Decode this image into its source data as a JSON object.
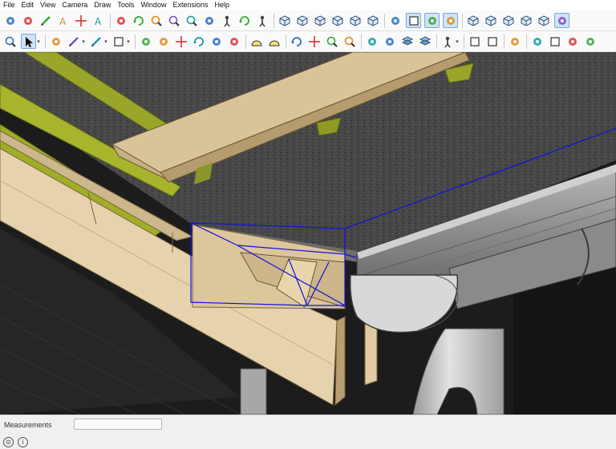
{
  "menu": [
    "File",
    "Edit",
    "View",
    "Camera",
    "Draw",
    "Tools",
    "Window",
    "Extensions",
    "Help"
  ],
  "toolbar_top": [
    {
      "icon": "select-location-icon"
    },
    {
      "icon": "paint-bucket-icon"
    },
    {
      "icon": "pencil-erase-icon"
    },
    {
      "icon": "text-icon"
    },
    {
      "icon": "axes-icon"
    },
    {
      "icon": "text-3d-icon"
    },
    {
      "sep": true
    },
    {
      "icon": "section-plane-icon"
    },
    {
      "icon": "orbit-icon"
    },
    {
      "icon": "zoom-icon"
    },
    {
      "icon": "zoom-window-icon"
    },
    {
      "icon": "zoom-extents-icon"
    },
    {
      "icon": "position-camera-icon"
    },
    {
      "icon": "walk-icon"
    },
    {
      "icon": "look-around-icon"
    },
    {
      "icon": "walker-icon"
    },
    {
      "sep": true
    },
    {
      "icon": "iso-view-icon"
    },
    {
      "icon": "top-view-icon"
    },
    {
      "icon": "front-view-icon"
    },
    {
      "icon": "right-view-icon"
    },
    {
      "icon": "back-view-icon"
    },
    {
      "icon": "left-view-icon"
    },
    {
      "sep": true
    },
    {
      "icon": "x-ray-icon"
    },
    {
      "icon": "wireframe-icon",
      "on": true
    },
    {
      "icon": "hidden-line-icon",
      "on": true
    },
    {
      "icon": "shaded-icon",
      "on": true
    },
    {
      "sep": true
    },
    {
      "icon": "component-icon"
    },
    {
      "icon": "group-icon"
    },
    {
      "icon": "solid-icon"
    },
    {
      "icon": "texture-cube-icon"
    },
    {
      "icon": "monochrome-icon"
    },
    {
      "icon": "more-icon",
      "on": true
    }
  ],
  "toolbar_bottom": [
    {
      "icon": "zoom-tool-icon"
    },
    {
      "icon": "select-arrow-icon",
      "on": true,
      "dd": true
    },
    {
      "sep": true
    },
    {
      "icon": "eraser-icon"
    },
    {
      "icon": "pencil-icon",
      "dd": true
    },
    {
      "icon": "arc-icon",
      "dd": true
    },
    {
      "icon": "rectangle-icon",
      "dd": true
    },
    {
      "sep": true
    },
    {
      "icon": "push-pull-icon"
    },
    {
      "icon": "follow-me-icon"
    },
    {
      "icon": "move-icon"
    },
    {
      "icon": "rotate-icon"
    },
    {
      "icon": "scale-icon"
    },
    {
      "icon": "offset-icon"
    },
    {
      "sep": true
    },
    {
      "icon": "tape-measure-icon"
    },
    {
      "icon": "protractor-icon"
    },
    {
      "sep": true
    },
    {
      "icon": "orbit-tool-icon"
    },
    {
      "icon": "pan-icon"
    },
    {
      "icon": "zoom-in-icon"
    },
    {
      "icon": "zoom-fit-icon"
    },
    {
      "sep": true
    },
    {
      "icon": "warehouse-icon"
    },
    {
      "icon": "extension-warehouse-icon"
    },
    {
      "icon": "layers-icon"
    },
    {
      "icon": "styles-icon"
    },
    {
      "sep": true
    },
    {
      "icon": "account-icon",
      "dd": true
    },
    {
      "sep": true
    },
    {
      "icon": "new-file-icon"
    },
    {
      "icon": "print-icon"
    },
    {
      "sep": true
    },
    {
      "icon": "door-icon"
    },
    {
      "sep": true
    },
    {
      "icon": "beam-icon"
    },
    {
      "icon": "frame-icon"
    },
    {
      "icon": "gutter-icon"
    },
    {
      "icon": "more-tools-icon"
    }
  ],
  "status": {
    "measurements_label": "Measurements",
    "measurements_value": "",
    "left_icons": [
      "geo-location-icon",
      "info-icon"
    ]
  },
  "colors": {
    "accent": "#7aaad8",
    "selection_blue": "#1010e0",
    "shingle_dark": "#3f3f3f",
    "batten_green": "#9aa62a",
    "wood_tan": "#ead8b0",
    "gutter_gray": "#8c8c8c"
  }
}
